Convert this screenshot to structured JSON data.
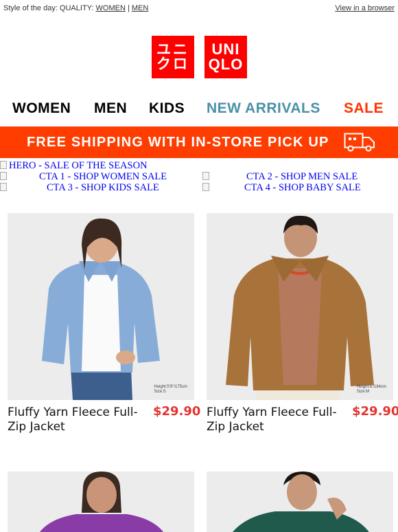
{
  "preheader": {
    "style_prefix": "Style of the day: QUALITY: ",
    "link_women": "WOMEN",
    "separator": " | ",
    "link_men": "MEN",
    "view_browser": "View in a browser"
  },
  "brand": {
    "logo_left_top": "ユニ",
    "logo_left_bottom": "クロ",
    "logo_right_top": "UNI",
    "logo_right_bottom": "QLO",
    "color": "#ff0000"
  },
  "nav": {
    "women": "WOMEN",
    "men": "MEN",
    "kids": "KIDS",
    "new_arrivals": "NEW ARRIVALS",
    "sale": "SALE",
    "new_arrivals_color": "#4a90a8",
    "sale_color": "#ff3300"
  },
  "shipping": {
    "text": "FREE SHIPPING WITH IN-STORE PICK UP",
    "icon": "truck-icon",
    "bg_color": "#ff3d00"
  },
  "ctas": {
    "hero": "HERO - SALE OF THE SEASON",
    "cta1": "CTA 1 - SHOP WOMEN SALE",
    "cta2": "CTA 2 - SHOP MEN SALE",
    "cta3": "CTA 3 - SHOP KIDS SALE",
    "cta4": "CTA 4 - SHOP BABY SALE"
  },
  "products": [
    {
      "name": "Fluffy Yarn Fleece Full-Zip Jacket",
      "price": "$29.90",
      "size_height": "Height:5'9\"/175cm",
      "size_size": "Size:S"
    },
    {
      "name": "Fluffy Yarn Fleece Full-Zip Jacket",
      "price": "$29.90",
      "size_height": "Height:6'/184cm",
      "size_size": "Size:M"
    }
  ],
  "price_color": "#e3342f"
}
